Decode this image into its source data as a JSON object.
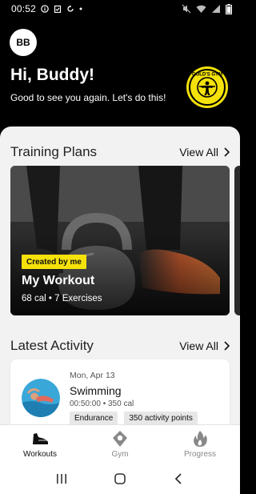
{
  "status_bar": {
    "time": "00:52",
    "left_icons": [
      "info-icon",
      "clipboard-icon",
      "sync-icon",
      "dot-icon"
    ],
    "right_icons": [
      "mute-icon",
      "wifi-icon",
      "signal-icon",
      "battery-icon"
    ]
  },
  "header": {
    "avatar_initials": "BB",
    "greeting": "Hi, Buddy!",
    "subgreeting": "Good to see you again. Let's do this!",
    "logo_text": "GOLD'S GYM"
  },
  "training_plans": {
    "title": "Training Plans",
    "view_all_label": "View All",
    "cards": [
      {
        "badge": "Created by me",
        "title": "My Workout",
        "meta": "68 cal • 7 Exercises"
      }
    ]
  },
  "latest_activity": {
    "title": "Latest Activity",
    "view_all_label": "View All",
    "items": [
      {
        "date": "Mon, Apr 13",
        "name": "Swimming",
        "meta": "00:50:00 • 350 cal",
        "tags": [
          "Endurance",
          "350 activity points"
        ]
      }
    ]
  },
  "bottom_nav": {
    "items": [
      {
        "label": "Workouts",
        "icon": "shoe-icon",
        "active": true
      },
      {
        "label": "Gym",
        "icon": "location-pin-icon",
        "active": false
      },
      {
        "label": "Progress",
        "icon": "flame-icon",
        "active": false
      }
    ]
  },
  "system_nav": [
    "recents-icon",
    "home-icon",
    "back-icon"
  ],
  "colors": {
    "header_bg": "#000000",
    "accent_yellow": "#f5e20a",
    "sheet_bg": "#f2f2f2",
    "active_nav": "#111111",
    "inactive_nav": "#888888"
  }
}
